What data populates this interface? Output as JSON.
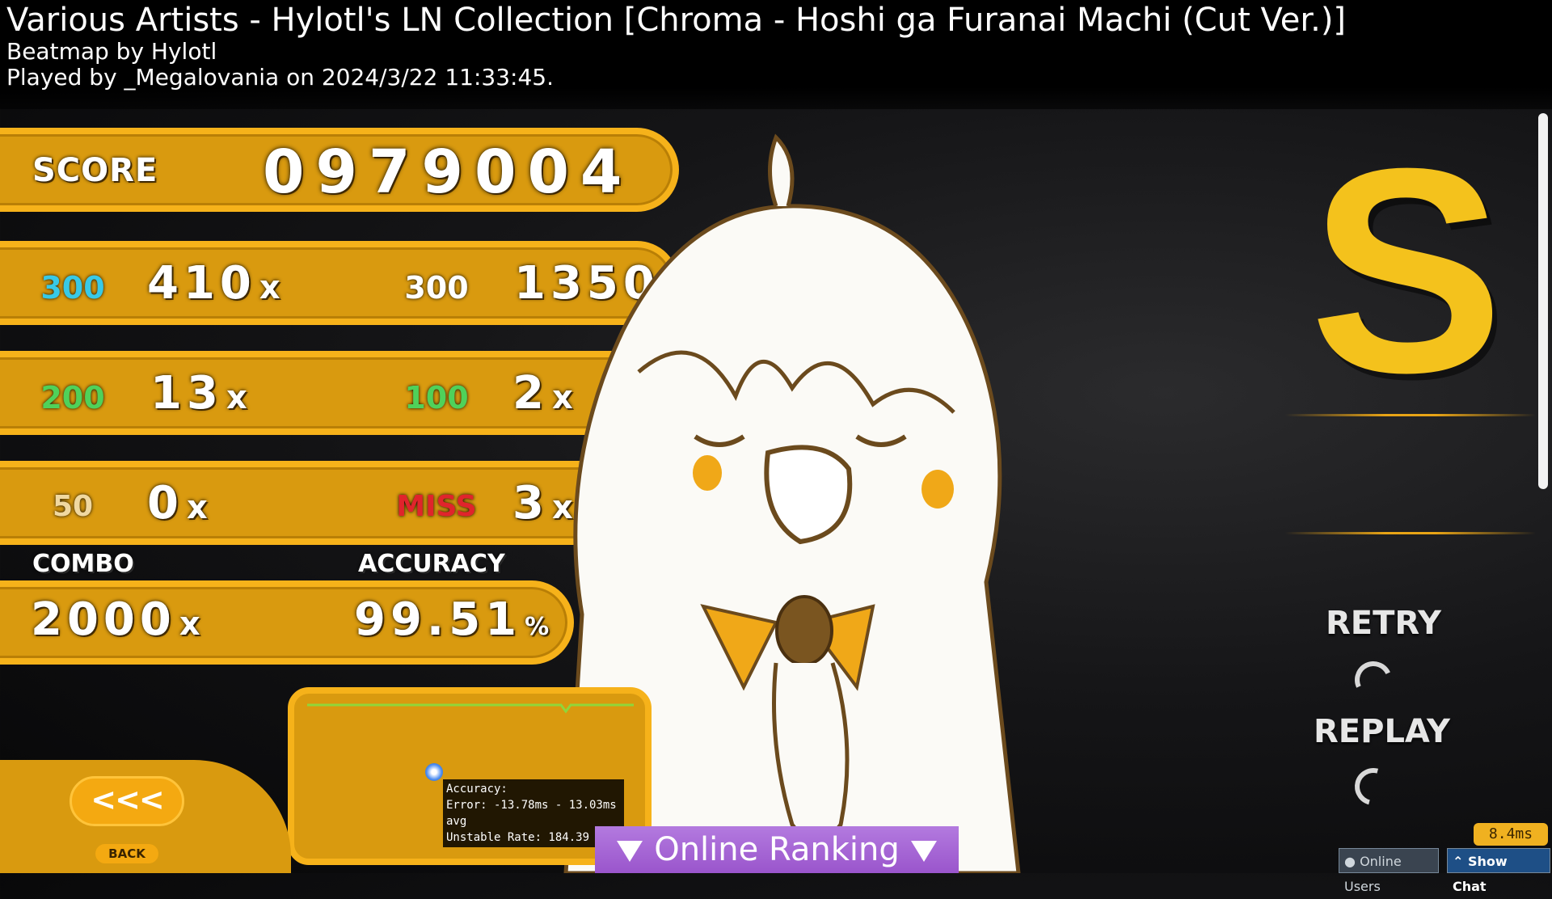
{
  "header": {
    "title": "Various Artists - Hylotl's LN Collection [Chroma - Hoshi ga Furanai Machi (Cut Ver.)]",
    "mapper": "Beatmap by Hylotl",
    "played": "Played by _Megalovania on 2024/3/22 11:33:45."
  },
  "score": {
    "label": "SCORE",
    "value": "0979004"
  },
  "judgements": [
    {
      "name": "300",
      "count": "410",
      "suffix": "x",
      "color": "#38c9e6"
    },
    {
      "name": "300",
      "count": "1350",
      "suffix": "x",
      "color": "#ffffff"
    },
    {
      "name": "200",
      "count": "13",
      "suffix": "x",
      "color": "#4fd15a"
    },
    {
      "name": "100",
      "count": "2",
      "suffix": "x",
      "color": "#4fd15a"
    },
    {
      "name": "50",
      "count": "0",
      "suffix": "x",
      "color": "#f0d8a0"
    },
    {
      "name": "MISS",
      "count": "3",
      "suffix": "x",
      "color": "#e0242c"
    }
  ],
  "combo": {
    "label": "COMBO",
    "value": "2000",
    "suffix": "x"
  },
  "accuracy": {
    "label": "ACCURACY",
    "value": "99.51",
    "suffix": "%"
  },
  "grade": "S",
  "side": {
    "retry": "RETRY",
    "replay": "REPLAY"
  },
  "tooltip": {
    "line1": "Accuracy:",
    "line2": "Error: -13.78ms - 13.03ms avg",
    "line3": "Unstable Rate: 184.39"
  },
  "back": {
    "arrows": "<<<",
    "label": "BACK"
  },
  "ranking": {
    "label": "Online Ranking"
  },
  "frametime": "8.4ms",
  "bottom": {
    "online_users": "Online Users",
    "show_chat": "Show Chat"
  },
  "colors": {
    "panel": "#d99a0f",
    "panel_border": "#f6b21a",
    "grade": "#f4c21c",
    "ranking": "#a462d4"
  }
}
